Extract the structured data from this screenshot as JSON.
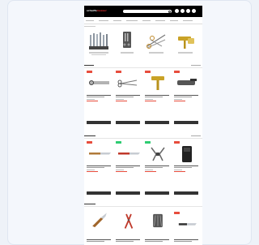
{
  "site": {
    "logo_main": "scharfe",
    "logo_accent": "messer"
  },
  "header_icons": [
    "account-icon",
    "wishlist-icon",
    "compare-icon",
    "cart-icon"
  ],
  "categories": [
    {
      "name": "knife-set",
      "icon": "knife-set-icon"
    },
    {
      "name": "scissors",
      "icon": "scissors-icon"
    },
    {
      "name": "tongs",
      "icon": "tongs-icon"
    },
    {
      "name": "razor",
      "icon": "razor-icon"
    }
  ],
  "sections": [
    {
      "products": [
        {
          "badge": "red",
          "image": "scissors-product"
        },
        {
          "badge": "red",
          "image": "nail-scissors-product"
        },
        {
          "badge": "red",
          "image": "safety-razor-product"
        },
        {
          "badge": "red",
          "image": "nail-clipper-product"
        }
      ]
    },
    {
      "products": [
        {
          "badge": "red",
          "image": "knife-product"
        },
        {
          "badge": "green",
          "image": "knife-product"
        },
        {
          "badge": "green",
          "image": "multitool-product"
        },
        {
          "badge": "red",
          "image": "pouch-product"
        }
      ]
    },
    {
      "products": [
        {
          "badge": "",
          "image": "folding-knife-product"
        },
        {
          "badge": "",
          "image": "pliers-product"
        },
        {
          "badge": "",
          "image": "multitool-product"
        },
        {
          "badge": "red",
          "image": "knife-product"
        }
      ]
    }
  ],
  "colors": {
    "header": "#000000",
    "accent": "#e74c3c",
    "badge_green": "#2ecc71",
    "button": "#333333"
  }
}
